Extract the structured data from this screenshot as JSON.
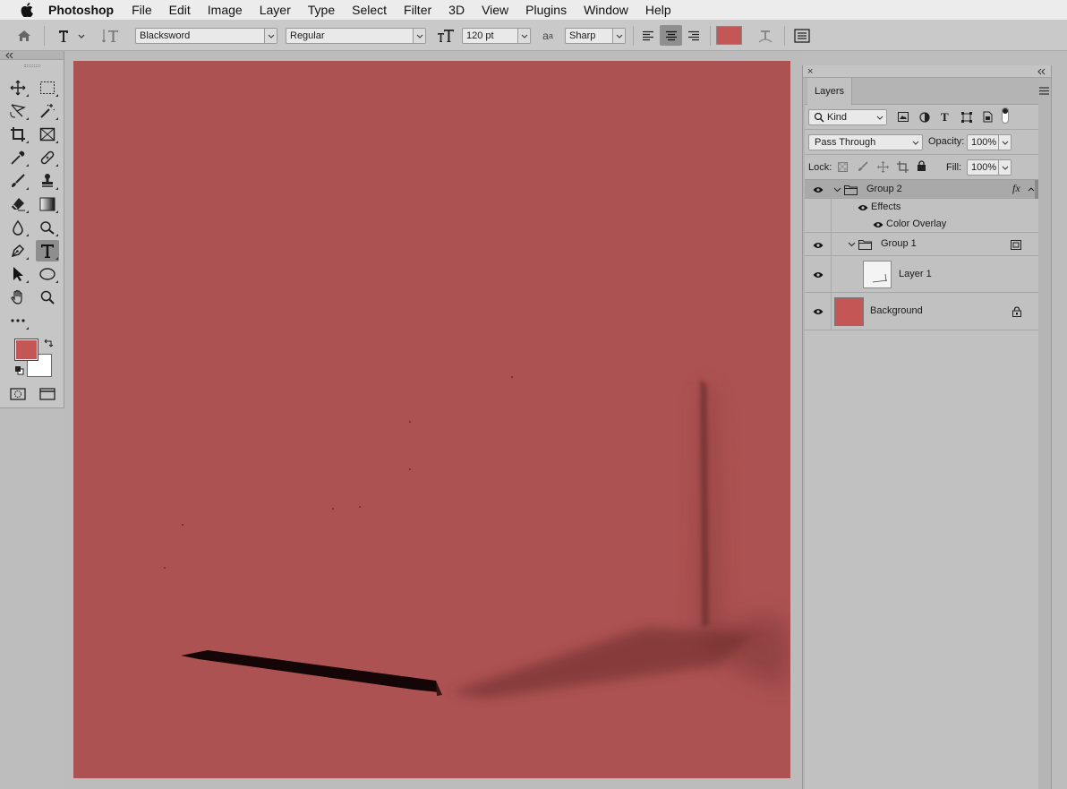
{
  "menubar": {
    "app": "Photoshop",
    "items": [
      "File",
      "Edit",
      "Image",
      "Layer",
      "Type",
      "Select",
      "Filter",
      "3D",
      "View",
      "Plugins",
      "Window",
      "Help"
    ]
  },
  "options": {
    "font_family": "Blacksword",
    "font_style": "Regular",
    "font_size": "120 pt",
    "antialias": "Sharp",
    "text_color": "#c55656"
  },
  "colors": {
    "foreground": "#c55656",
    "background": "#ffffff",
    "canvas": "#ad5252"
  },
  "layers": {
    "tab": "Layers",
    "filter_kind": "Kind",
    "blend_mode": "Pass Through",
    "opacity_label": "Opacity:",
    "opacity": "100%",
    "lock_label": "Lock:",
    "fill_label": "Fill:",
    "fill": "100%",
    "group2": "Group 2",
    "effects": "Effects",
    "color_overlay": "Color Overlay",
    "group1": "Group 1",
    "layer1": "Layer 1",
    "background": "Background"
  }
}
